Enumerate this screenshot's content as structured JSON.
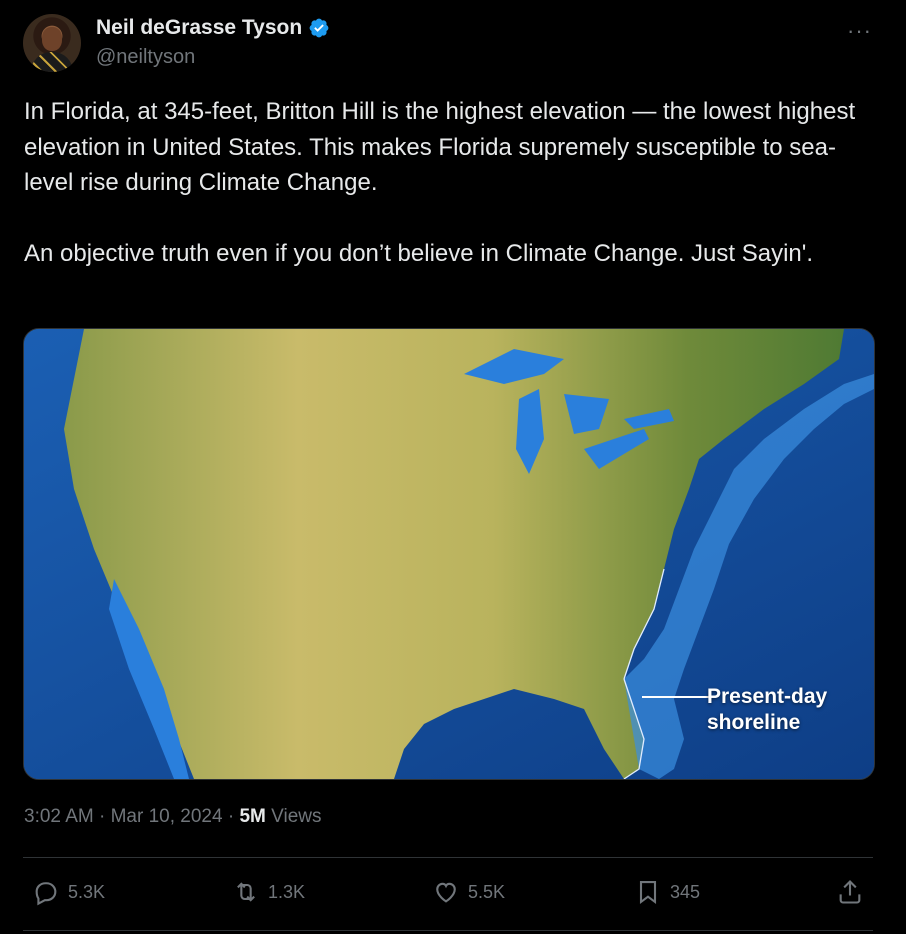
{
  "author": {
    "name": "Neil deGrasse Tyson",
    "handle": "@neiltyson"
  },
  "tweet": {
    "paragraphs": [
      "In Florida, at 345-feet, Britton Hill is the highest elevation — the lowest highest elevation in United States. This makes Florida supremely susceptible to sea-level rise during Climate Change.",
      "An objective truth even if you don’t believe in Climate Change.  Just Sayin'."
    ]
  },
  "media": {
    "caption": "Present-day shoreline"
  },
  "meta": {
    "time": "3:02 AM",
    "date": "Mar 10, 2024",
    "views_count": "5M",
    "views_label": "Views"
  },
  "actions": {
    "replies": "5.3K",
    "reposts": "1.3K",
    "likes": "5.5K",
    "bookmarks": "345"
  },
  "colors": {
    "background": "#000000",
    "text": "#e7e9ea",
    "muted": "#71767b",
    "verified": "#1d9bf0"
  }
}
